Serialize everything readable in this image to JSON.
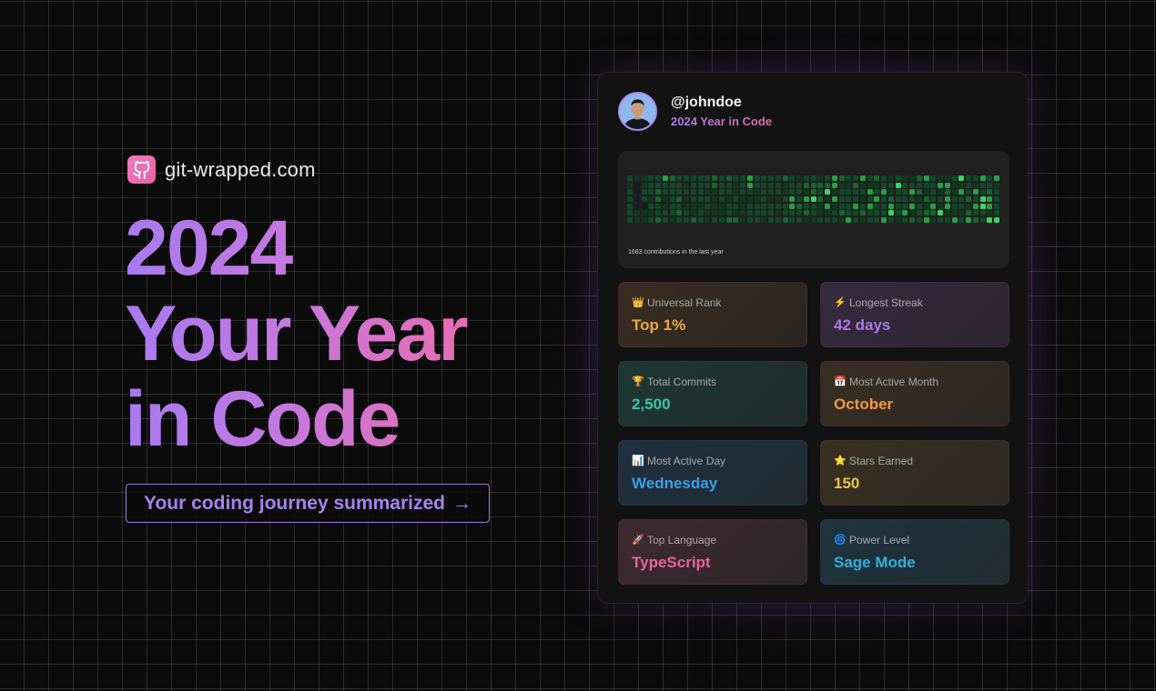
{
  "brand": {
    "logo_icon": "github-octocat-icon",
    "logo_color": "#ec6fb4",
    "site": "git-wrapped.com"
  },
  "hero": {
    "title_lines": [
      "2024",
      "Your Year",
      "in Code"
    ],
    "gradient": [
      "#a77af0",
      "#f06ba8"
    ],
    "cta_label": "Your coding journey summarized",
    "cta_arrow": "→"
  },
  "profile": {
    "avatar_icon": "user-avatar",
    "username": "@johndoe",
    "subtitle": "2024 Year in Code"
  },
  "contributions": {
    "label": "1683 contributions in the last year",
    "columns": 53,
    "rows": 7,
    "palette": [
      "#161b22",
      "#0e3a1c",
      "#11492a",
      "#17652f",
      "#27a044",
      "#3ed364"
    ],
    "highlights": [
      [
        5,
        0,
        4
      ],
      [
        17,
        0,
        4
      ],
      [
        29,
        0,
        4
      ],
      [
        33,
        0,
        4
      ],
      [
        47,
        0,
        5
      ],
      [
        52,
        0,
        4
      ],
      [
        42,
        0,
        4
      ],
      [
        50,
        0,
        4
      ],
      [
        17,
        1,
        4
      ],
      [
        29,
        1,
        4
      ],
      [
        38,
        1,
        5
      ],
      [
        44,
        1,
        4
      ],
      [
        53,
        1,
        3
      ],
      [
        45,
        1,
        4
      ],
      [
        34,
        2,
        4
      ],
      [
        49,
        2,
        4
      ],
      [
        40,
        2,
        4
      ],
      [
        28,
        2,
        5
      ],
      [
        36,
        2,
        4
      ],
      [
        47,
        2,
        4
      ],
      [
        23,
        3,
        4
      ],
      [
        25,
        3,
        4
      ],
      [
        26,
        3,
        5
      ],
      [
        29,
        3,
        4
      ],
      [
        35,
        3,
        4
      ],
      [
        50,
        3,
        5
      ],
      [
        45,
        3,
        4
      ],
      [
        51,
        3,
        4
      ],
      [
        42,
        3,
        3
      ],
      [
        23,
        4,
        4
      ],
      [
        28,
        4,
        4
      ],
      [
        32,
        4,
        4
      ],
      [
        34,
        4,
        4
      ],
      [
        37,
        4,
        4
      ],
      [
        40,
        4,
        4
      ],
      [
        43,
        4,
        4
      ],
      [
        49,
        4,
        4
      ],
      [
        50,
        4,
        5
      ],
      [
        51,
        4,
        4
      ],
      [
        45,
        4,
        4
      ],
      [
        44,
        5,
        5
      ],
      [
        39,
        5,
        4
      ],
      [
        37,
        5,
        5
      ],
      [
        31,
        6,
        4
      ],
      [
        36,
        6,
        4
      ],
      [
        46,
        6,
        4
      ],
      [
        48,
        6,
        4
      ],
      [
        51,
        6,
        5
      ],
      [
        52,
        6,
        5
      ],
      [
        42,
        6,
        4
      ]
    ]
  },
  "stats": [
    {
      "icon": "crown-icon",
      "glyph": "👑",
      "label": "Universal Rank",
      "value": "Top 1%",
      "color": "#e9a93c",
      "bg": [
        "#3a2d20",
        "#2b2420"
      ]
    },
    {
      "icon": "lightning-icon",
      "glyph": "⚡",
      "label": "Longest Streak",
      "value": "42 days",
      "color": "#a97ae6",
      "bg": [
        "#372a40",
        "#2b2430"
      ]
    },
    {
      "icon": "trophy-icon",
      "glyph": "🏆",
      "label": "Total Commits",
      "value": "2,500",
      "color": "#39c6ae",
      "bg": [
        "#1d3834",
        "#202b2a"
      ]
    },
    {
      "icon": "calendar-icon",
      "glyph": "📅",
      "label": "Most Active Month",
      "value": "October",
      "color": "#ee9a3f",
      "bg": [
        "#3a2e22",
        "#2c2622"
      ]
    },
    {
      "icon": "bar-chart-icon",
      "glyph": "📊",
      "label": "Most Active Day",
      "value": "Wednesday",
      "color": "#3aa0e6",
      "bg": [
        "#1f3040",
        "#212a32"
      ]
    },
    {
      "icon": "star-icon",
      "glyph": "⭐",
      "label": "Stars Earned",
      "value": "150",
      "color": "#e9c24a",
      "bg": [
        "#3a3022",
        "#2d2822"
      ]
    },
    {
      "icon": "rocket-icon",
      "glyph": "🚀",
      "label": "Top Language",
      "value": "TypeScript",
      "color": "#e6659a",
      "bg": [
        "#3e2a30",
        "#2e2528"
      ]
    },
    {
      "icon": "cyclone-icon",
      "glyph": "🌀",
      "label": "Power Level",
      "value": "Sage Mode",
      "color": "#2fb0d8",
      "bg": [
        "#1f3440",
        "#212b32"
      ]
    }
  ]
}
